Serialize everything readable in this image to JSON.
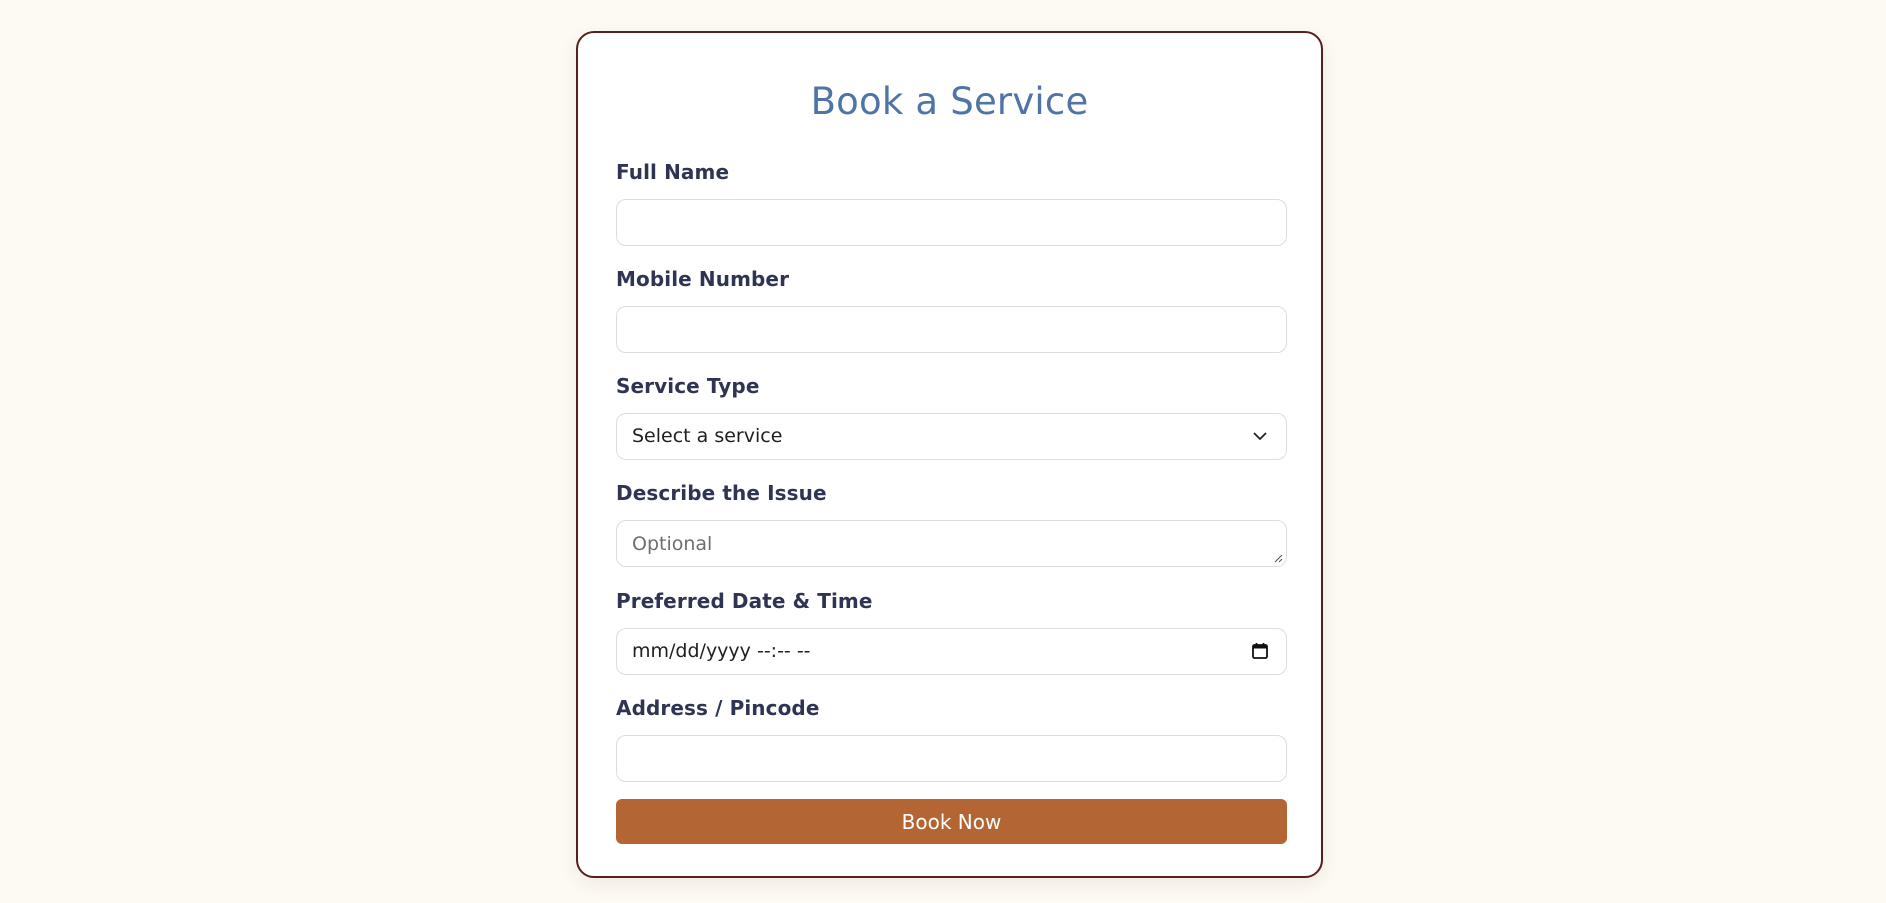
{
  "form": {
    "title": "Book a Service",
    "full_name": {
      "label": "Full Name",
      "value": "",
      "placeholder": ""
    },
    "mobile": {
      "label": "Mobile Number",
      "value": "",
      "placeholder": ""
    },
    "service_type": {
      "label": "Service Type",
      "selected": "Select a service"
    },
    "issue": {
      "label": "Describe the Issue",
      "value": "",
      "placeholder": "Optional"
    },
    "datetime": {
      "label": "Preferred Date & Time",
      "display": "mm/dd/yyyy --:-- --"
    },
    "address": {
      "label": "Address / Pincode",
      "value": "",
      "placeholder": ""
    },
    "submit_label": "Book Now"
  },
  "icons": {
    "service_dropdown": "chevron-down-icon",
    "datetime_picker": "calendar-icon",
    "textarea_resize": "resize-handle-icon"
  },
  "colors": {
    "page_background": "#fdf9f3",
    "card_border": "#5a1e1e",
    "title": "#4f74a6",
    "label": "#2e3452",
    "button": "#b36634",
    "button_text": "#ffffff",
    "input_border": "#dcdde3"
  }
}
